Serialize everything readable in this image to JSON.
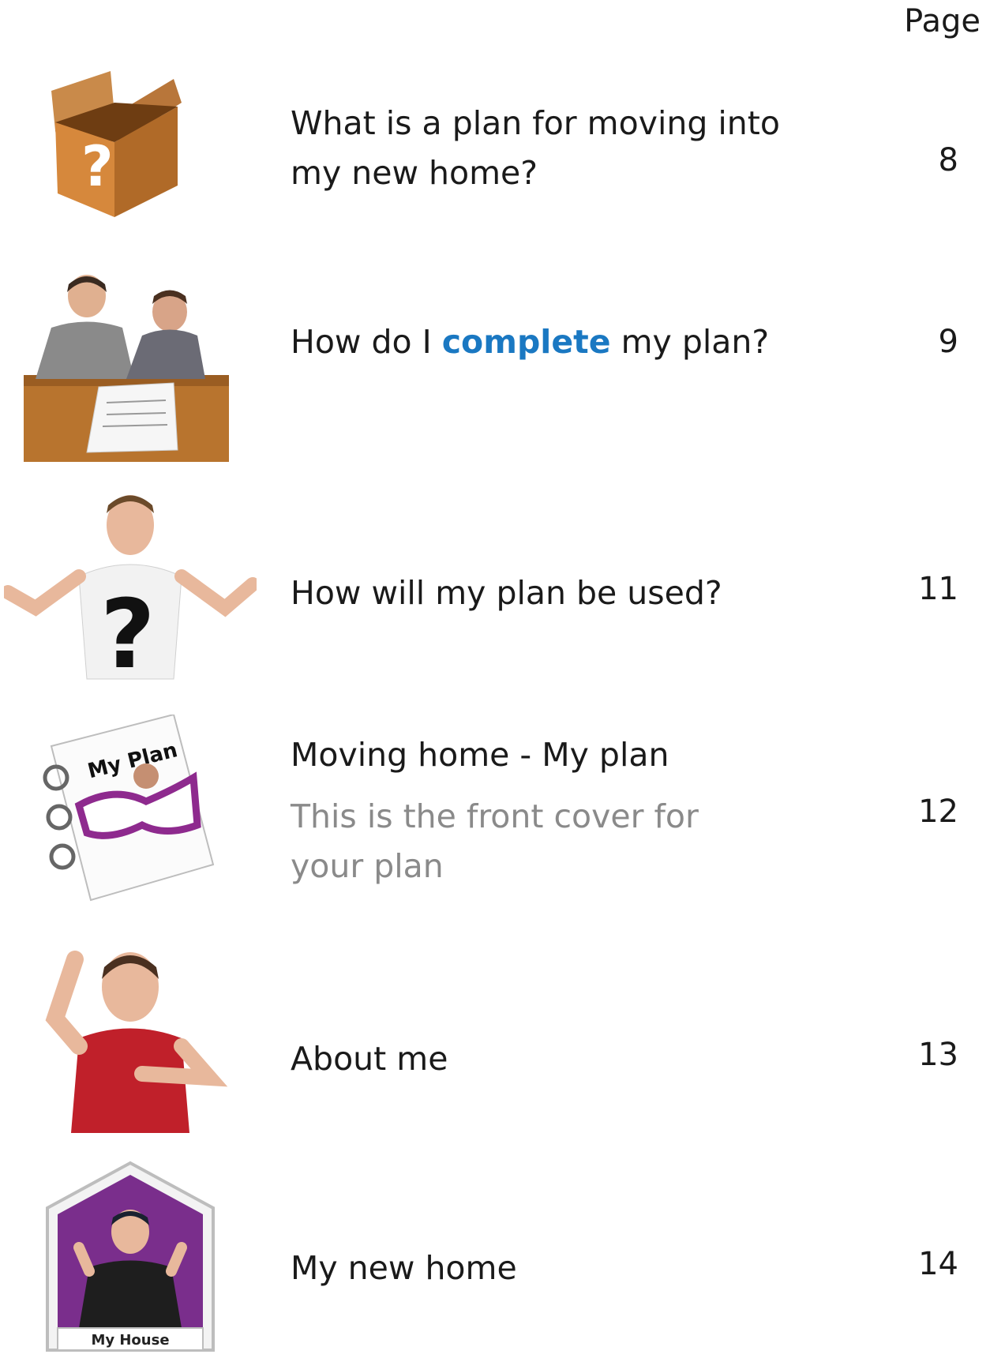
{
  "header": {
    "page_label": "Page"
  },
  "colors": {
    "keyword": "#1a78c2",
    "subtitle": "#8a8a8a",
    "house_purple": "#7a2e8c"
  },
  "entries": [
    {
      "title": "What is a plan for moving into my new home?",
      "page": "8",
      "icon": "question-box-icon"
    },
    {
      "title_before": "How do I ",
      "title_keyword": "complete",
      "title_after": " my plan?",
      "page": "9",
      "icon": "signing-form-icon"
    },
    {
      "title": "How will my plan be used?",
      "page": "11",
      "icon": "confused-person-icon"
    },
    {
      "title": "Moving home - My plan",
      "subtitle": "This is the front cover for your plan",
      "page": "12",
      "icon": "my-plan-notebook-icon",
      "icon_text": "My Plan"
    },
    {
      "title": "About me",
      "page": "13",
      "icon": "person-pointing-self-icon"
    },
    {
      "title": "My new home",
      "page": "14",
      "icon": "my-house-icon",
      "icon_text": "My House"
    }
  ]
}
